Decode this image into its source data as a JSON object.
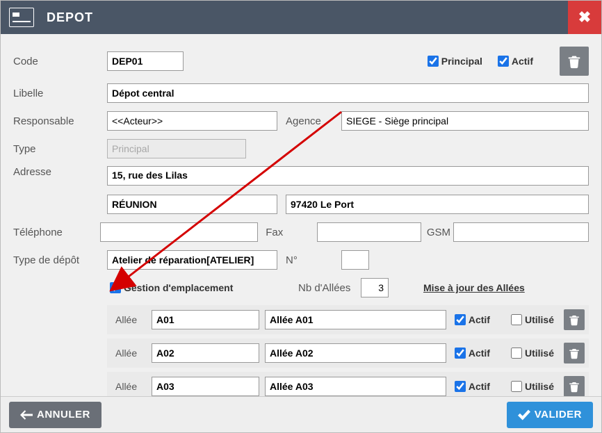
{
  "window": {
    "title": "DEPOT"
  },
  "labels": {
    "code": "Code",
    "libelle": "Libelle",
    "responsable": "Responsable",
    "agence": "Agence",
    "type": "Type",
    "adresse": "Adresse",
    "telephone": "Téléphone",
    "fax": "Fax",
    "gsm": "GSM",
    "typeDepot": "Type de dépôt",
    "numero": "N°",
    "nbAllees": "Nb d'Allées",
    "gestionEmplacement": "Gestion d'emplacement",
    "miseAJourAllees": "Mise à jour des Allées",
    "principal": "Principal",
    "actif": "Actif",
    "utilise": "Utilisé",
    "allee": "Allée"
  },
  "values": {
    "code": "DEP01",
    "libelle": "Dépot central",
    "responsable": "<<Acteur>>",
    "agence": "SIEGE - Siège principal",
    "type": "Principal",
    "adresse": "15, rue des Lilas",
    "ile": "RÉUNION",
    "cpVille": "97420 Le Port",
    "telephone": "",
    "fax": "",
    "gsm": "",
    "typeDepot": "Atelier de réparation[ATELIER]",
    "numero": "",
    "nbAllees": "3",
    "principalChecked": true,
    "actifChecked": true,
    "gestionEmplacementChecked": true
  },
  "allees": [
    {
      "code": "A01",
      "label": "Allée A01",
      "actif": true,
      "utilise": false
    },
    {
      "code": "A02",
      "label": "Allée A02",
      "actif": true,
      "utilise": false
    },
    {
      "code": "A03",
      "label": "Allée A03",
      "actif": true,
      "utilise": false
    }
  ],
  "buttons": {
    "annuler": "ANNULER",
    "valider": "VALIDER"
  }
}
